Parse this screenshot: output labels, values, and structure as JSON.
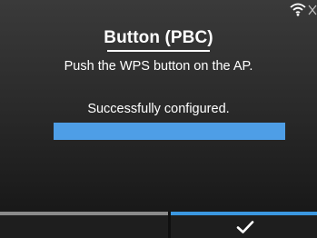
{
  "header": {
    "title": "Button (PBC)",
    "instruction": "Push the WPS button on the AP.",
    "status_icons": [
      "wifi-icon",
      "signal-icon"
    ]
  },
  "status": {
    "message": "Successfully configured.",
    "progress_percent": 100
  },
  "softkeys": {
    "left_label": "",
    "right_icon": "check-icon"
  },
  "colors": {
    "accent": "#3b97e0",
    "progress": "#4e9ee6",
    "inactive_key": "#8a8a8a"
  }
}
